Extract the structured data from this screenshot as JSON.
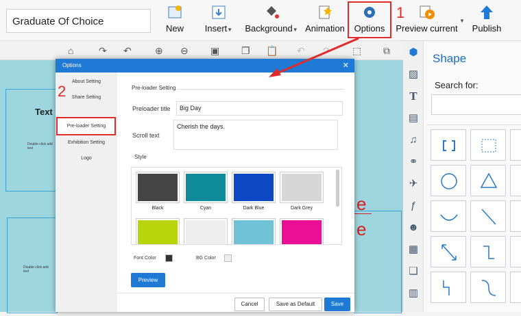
{
  "title_field": {
    "value": "Graduate Of Choice"
  },
  "ribbon": {
    "new": "New",
    "insert": "Insert",
    "background": "Background",
    "animation": "Animation",
    "options": "Options",
    "preview": "Preview current",
    "publish": "Publish"
  },
  "annotations": {
    "step1": "1",
    "step2": "2"
  },
  "canvas": {
    "text_label": "Text",
    "text_hint1": "Double click add text",
    "text_hint2": "Double click add text"
  },
  "shape_panel": {
    "title": "Shape",
    "search_label": "Search for:"
  },
  "modal": {
    "title": "Options",
    "nav": [
      "About Setting",
      "Share Setting",
      "Pre-loader Setting",
      "Exhibition Setting",
      "Logo"
    ],
    "section_title": "Pre-loader Setting",
    "preloader_title_label": "Preloader title",
    "preloader_title_value": "Big Day",
    "scroll_text_label": "Scroll text",
    "scroll_text_value": "Cherish the days.",
    "style_label": "Style",
    "styles": [
      {
        "name": "Black",
        "color": "#444444"
      },
      {
        "name": "Cyan",
        "color": "#0f8a99"
      },
      {
        "name": "Dark Blue",
        "color": "#0d47c4"
      },
      {
        "name": "Dark Grey",
        "color": "#d6d6d6"
      },
      {
        "name": "",
        "color": "#b8d40a"
      },
      {
        "name": "",
        "color": "#eeeeee"
      },
      {
        "name": "",
        "color": "#70c2d6"
      },
      {
        "name": "",
        "color": "#ea0f94"
      }
    ],
    "font_color_label": "Font Color",
    "bg_color_label": "BG Color",
    "preview_btn": "Preview",
    "cancel_btn": "Cancel",
    "save_default_btn": "Save as Default",
    "save_btn": "Save"
  }
}
